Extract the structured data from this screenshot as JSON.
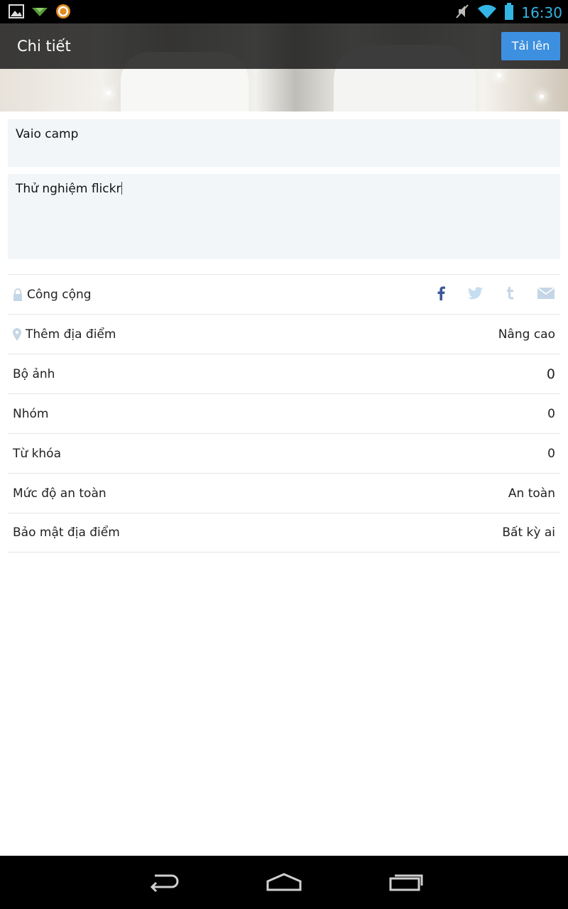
{
  "status_bar": {
    "time": "16:30",
    "icons": [
      "gallery-notification-icon",
      "download-notification-icon",
      "app-notification-icon",
      "mute-icon",
      "wifi-icon",
      "battery-icon"
    ]
  },
  "action_bar": {
    "title": "Chi tiết",
    "upload_label": "Tải lên"
  },
  "form": {
    "title_value": "Vaio camp",
    "description_value": "Thử nghiệm flickr"
  },
  "rows": {
    "privacy_label": "Công cộng",
    "share_icons": [
      "facebook-icon",
      "twitter-icon",
      "tumblr-icon",
      "email-icon"
    ],
    "location_label": "Thêm địa điểm",
    "advanced_label": "Nâng cao",
    "sets_label": "Bộ ảnh",
    "sets_value": "0",
    "groups_label": "Nhóm",
    "groups_value": "0",
    "tags_label": "Từ khóa",
    "tags_value": "0",
    "safety_label": "Mức độ an toàn",
    "safety_value": "An toàn",
    "geo_privacy_label": "Bảo mật địa điểm",
    "geo_privacy_value": "Bất kỳ ai"
  },
  "colors": {
    "accent": "#3d8fdf",
    "status_time": "#33b5e5",
    "field_bg": "#f2f6f9",
    "facebook": "#3b5998",
    "twitter": "#c5ddf0"
  },
  "nav_bar": {
    "buttons": [
      "back-icon",
      "home-icon",
      "recents-icon"
    ]
  }
}
